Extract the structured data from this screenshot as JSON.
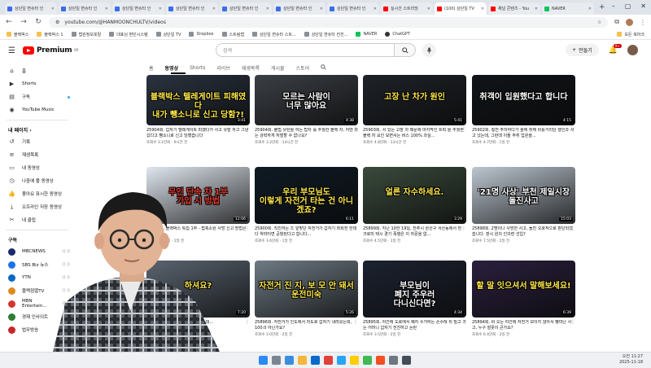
{
  "browser": {
    "tabs": [
      {
        "title": "상단일 변슈타 인",
        "icon": "blue"
      },
      {
        "title": "상단일 변슈타 인",
        "icon": "blue"
      },
      {
        "title": "상단일 변슈타 인",
        "icon": "blue"
      },
      {
        "title": "상단일 변슈타 인",
        "icon": "blue"
      },
      {
        "title": "상단일 변슈타 인",
        "icon": "blue"
      },
      {
        "title": "상단일 변슈타 인",
        "icon": "blue"
      },
      {
        "title": "상단일 변슈타 인",
        "icon": "blue"
      },
      {
        "title": "실시간 스트리밍",
        "icon": "red"
      },
      {
        "title": "(100) 상단일 TV",
        "icon": "red",
        "active": true
      },
      {
        "title": "채널 콘텐츠 - You",
        "icon": "red"
      },
      {
        "title": "NAVER",
        "icon": "green"
      }
    ],
    "url": "youtube.com/@HANMOONCHULTV/videos",
    "bookmarks": [
      {
        "label": "블랙박스",
        "type": "folder"
      },
      {
        "label": "블랙박스 1",
        "type": "folder"
      },
      {
        "label": "법원정보포탈",
        "type": "site"
      },
      {
        "label": "대표님 편민시스템",
        "type": "site"
      },
      {
        "label": "상단일 TV",
        "type": "site"
      },
      {
        "label": "Dropbox",
        "type": "site"
      },
      {
        "label": "스트림랩",
        "type": "site"
      },
      {
        "label": "상단일 변슈타 스트...",
        "type": "site"
      },
      {
        "label": "상단일 변슈타 컨진...",
        "type": "site"
      },
      {
        "label": "NAVER",
        "type": "naver"
      },
      {
        "label": "ChatGPT",
        "type": "gpt"
      }
    ],
    "bookmarks_right": "모든 북마크"
  },
  "youtube": {
    "logo_text": "Premium",
    "logo_region": "KR",
    "search_placeholder": "검색",
    "create_label": "만들기",
    "notif_count": "9+",
    "channel_tabs": [
      {
        "label": "홈",
        "active": false
      },
      {
        "label": "동영상",
        "active": true
      },
      {
        "label": "Shorts",
        "active": false
      },
      {
        "label": "라이브",
        "active": false
      },
      {
        "label": "재생목록",
        "active": false
      },
      {
        "label": "게시물",
        "active": false
      },
      {
        "label": "스토어",
        "active": false
      }
    ]
  },
  "sidebar": {
    "main": [
      {
        "label": "홈",
        "icon": "home-icon"
      },
      {
        "label": "Shorts",
        "icon": "shorts-icon"
      },
      {
        "label": "구독",
        "icon": "subscriptions-icon"
      },
      {
        "label": "YouTube Music",
        "icon": "music-icon"
      }
    ],
    "you_header": "내 페이지 ›",
    "you": [
      {
        "label": "기록",
        "icon": "history-icon"
      },
      {
        "label": "재생목록",
        "icon": "playlist-icon"
      },
      {
        "label": "내 동영상",
        "icon": "my-videos-icon"
      },
      {
        "label": "나중에 볼 동영상",
        "icon": "watch-later-icon"
      },
      {
        "label": "좋아요 표시한 동영상",
        "icon": "like-icon"
      },
      {
        "label": "오프라인 저장 동영상",
        "icon": "download-icon"
      },
      {
        "label": "내 클립",
        "icon": "clip-icon"
      }
    ],
    "subs_header": "구독",
    "subs": [
      {
        "label": "MBCNEWS",
        "color": "#1b2a6b"
      },
      {
        "label": "SBS Biz 뉴스",
        "color": "#1a73e8"
      },
      {
        "label": "YTN",
        "color": "#0b67c2"
      },
      {
        "label": "블랙점멸TV",
        "color": "#e08a1e"
      },
      {
        "label": "MBN Entertain...",
        "color": "#d4352d"
      },
      {
        "label": "경제 인사이트",
        "color": "#2e7d32"
      },
      {
        "label": "법무방송",
        "color": "#c62828"
      }
    ]
  },
  "videos": [
    {
      "caption": "블랙박스 텔레게이트 피해였다\n내가 뺑소니로 신고 당함?!",
      "cap_color": "#ffe94a",
      "bg": "#2a3340",
      "duration": "3:41",
      "title": "25904회. 갑자기 텔레게이트 피했다가 사고 유발 하고 그냥 갔다고 뺑소니로 신고 당했습니다",
      "meta": "조회수 3.1만회 · 9시간 전"
    },
    {
      "caption": "모르는 사람이\n너무 많아요",
      "cap_color": "#ffffff",
      "bg": "#3b3f45",
      "duration": "4:38",
      "title": "25904회. 불법 유턴을 하는 탑차 를 추월한 블랙 차, 어떤 차는 강력하게 처벌할 수 없나요?",
      "meta": "조회수 3.2만회 · 14시간 전"
    },
    {
      "caption": "고장 난 차가 원인",
      "cap_color": "#ffe94a",
      "bg": "#1e2228",
      "duration": "5:41",
      "title": "25903회. 서 있는 고장 차 때문에 마지막인 트럭 을 추월한 블랙 차 요인 보면서는 버스 100% 과실...",
      "meta": "조회수 4.8만회 · 13시간 전"
    },
    {
      "caption": "취객이 입원했다고 합니다",
      "cap_color": "#ffffff",
      "bg": "#101418",
      "duration": "4:15",
      "title": "25902회. 횡전 주차하다가 술에 취해 비틀거리던 행인과 사고 났는데, 그런데 이들 주취 입원을...",
      "meta": "조회수 4.7만회 · 1일 전"
    },
    {
      "caption": "무인 단속 차 1부\n가입 시 방법",
      "cap_color": "#e5382d",
      "bg": "#dfe6ee",
      "duration": "12:06",
      "title": "25901회. 블랙박스 특집 1부 - 접촉소원 사망 신고 방법은 없다면?",
      "meta": "조회수 2.8만회 · 1일 전"
    },
    {
      "caption": "우리 부모님도\n이렇게 자전거 타는 건 아니겠죠?",
      "cap_color": "#ffe94a",
      "bg": "#0f1a24",
      "duration": "6:11",
      "title": "25900회. 직진하는 츠 앞맞단 자전거가 갑자기 좌회전 한데다 하마터면 공항된다고 합니다...",
      "meta": "조회수 3.6만회 · 1일 전"
    },
    {
      "caption": "얼른 자수하세요.",
      "cap_color": "#ffe94a",
      "bg": "#3a4a3c",
      "duration": "3:29",
      "title": "25899회. 지난 10한 19일, 전주시 완산구 서산동에서 흰 크로미 택시 경기 폭행은 이 자문을 없...",
      "meta": "조회수 4.5만회 · 1일 전"
    },
    {
      "caption": "'21명 사상' 부천 제일시장 돌진사고",
      "cap_color": "#ffffff",
      "bg": "#bcc6d0",
      "duration": "15:03",
      "title": "25898회. 2명이나 사망한 사고, 돌진 오호작으로 판단되었습니다. 판시 원의 인의련 선입?",
      "meta": "조회수 7.5만회 · 2일 전"
    },
    {
      "caption": "하셔요?",
      "cap_color": "#ffe94a",
      "bg": "#5a6470",
      "duration": "7:20",
      "title": "25897회. 상대가 갑자기 붙어왔는데...",
      "meta": "조회수 2.2만회 · 2일 전"
    },
    {
      "caption": "자전거 진 지, 보 모 안 돼서\n운전미숙",
      "cap_color": "#ffe94a",
      "bg": "#6e7a84",
      "duration": "5:26",
      "title": "25896회. 자전거가 인도에서 차도로 갑자기 내려왔는데, 100:0 아닌가요?",
      "meta": "조회수 3.0만회 · 2일 전"
    },
    {
      "caption": "부모님이\n폐지 주우러\n다니신다면?",
      "cap_color": "#ffffff",
      "bg": "#1c2230",
      "duration": "4:34",
      "title": "25895회. 야간에 도로에서 폐지 수거하는 손수레 뒤 밀고 가는 어머니 갑자기 전진하고 논란",
      "meta": "조회수 3.5만회 · 2일 전"
    },
    {
      "caption": "할 말 잇으셔서 말해보세요!",
      "cap_color": "#ffe94a",
      "bg": "#2a1f3d",
      "duration": "6:39",
      "title": "25894회. 비 오는 야간에 자전거 보이지 않아서 빵마난 사고, 누구 잘못이 큰가요?",
      "meta": "조회수 6.4만회 · 2일 전"
    }
  ],
  "taskbar": {
    "time": "오전 11:27",
    "date": "2025-11-18"
  },
  "colors": {
    "yt_red": "#ff0000",
    "accent_blue": "#3ea6ff"
  }
}
